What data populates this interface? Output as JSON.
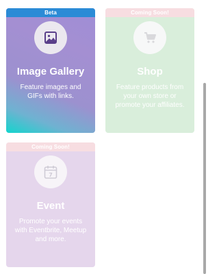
{
  "cards": [
    {
      "banner": "Beta",
      "title": "Image Gallery",
      "description": "Feature images and GIFs with links.",
      "icon": "image-icon"
    },
    {
      "banner": "Coming Soon!",
      "title": "Shop",
      "description": "Feature products from your own store or promote your affiliates.",
      "icon": "cart-icon"
    },
    {
      "banner": "Coming Soon!",
      "title": "Event",
      "description": "Promote your events with Eventbrite, Meetup and more.",
      "icon": "calendar-icon"
    }
  ],
  "colors": {
    "beta_banner": "#2b8bd6",
    "coming_soon_banner": "#f7dde1",
    "gallery_gradient_start": "#12d5cd",
    "gallery_gradient_end": "#a48fd2",
    "shop_background": "#d9eedb",
    "event_background": "#e5d6ec"
  }
}
